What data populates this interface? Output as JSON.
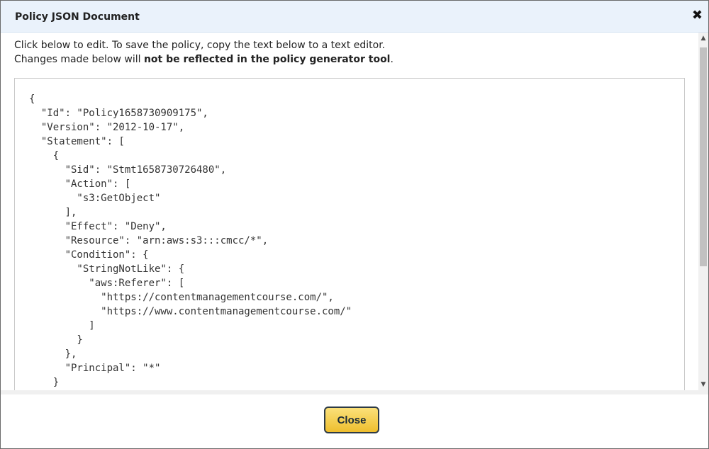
{
  "dialog": {
    "title": "Policy JSON Document",
    "close_glyph": "✖",
    "instructions": {
      "line1": "Click below to edit. To save the policy, copy the text below to a text editor.",
      "line2_prefix": "Changes made below will ",
      "line2_bold": "not be reflected in the policy generator tool",
      "line2_suffix": "."
    },
    "policy_json": "{\n  \"Id\": \"Policy1658730909175\",\n  \"Version\": \"2012-10-17\",\n  \"Statement\": [\n    {\n      \"Sid\": \"Stmt1658730726480\",\n      \"Action\": [\n        \"s3:GetObject\"\n      ],\n      \"Effect\": \"Deny\",\n      \"Resource\": \"arn:aws:s3:::cmcc/*\",\n      \"Condition\": {\n        \"StringNotLike\": {\n          \"aws:Referer\": [\n            \"https://contentmanagementcourse.com/\",\n            \"https://www.contentmanagementcourse.com/\"\n          ]\n        }\n      },\n      \"Principal\": \"*\"\n    }",
    "scroll_up_glyph": "▲",
    "scroll_down_glyph": "▼",
    "close_button_label": "Close"
  },
  "colors": {
    "titlebar_bg": "#eaf2fb",
    "button_gradient_top": "#fbe17a",
    "button_gradient_bottom": "#eebe2e"
  }
}
